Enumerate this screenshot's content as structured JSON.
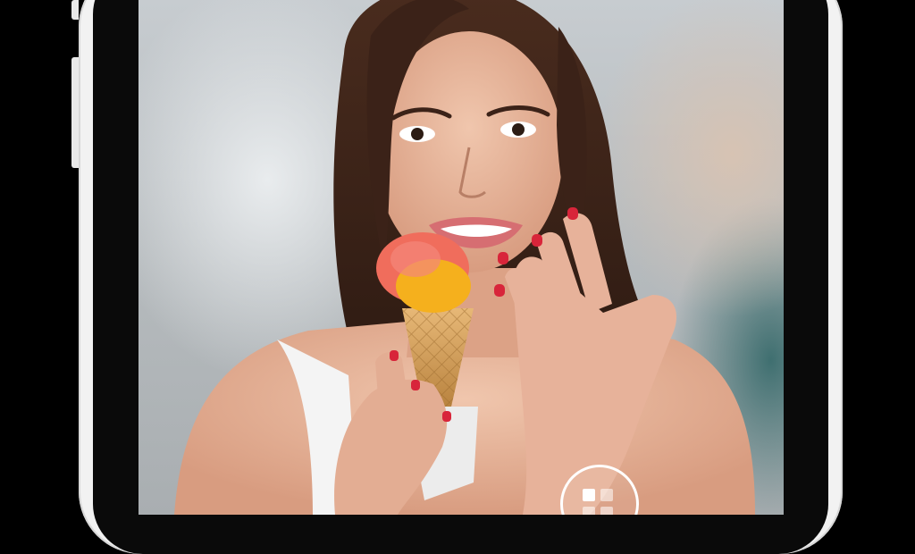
{
  "device": {
    "frame_color": "#f2f2f2",
    "bezel_color": "#0a0a0a"
  },
  "camera": {
    "mode_toggle_icon": "grid-mode-icon",
    "photo_subject": "person-photo"
  }
}
